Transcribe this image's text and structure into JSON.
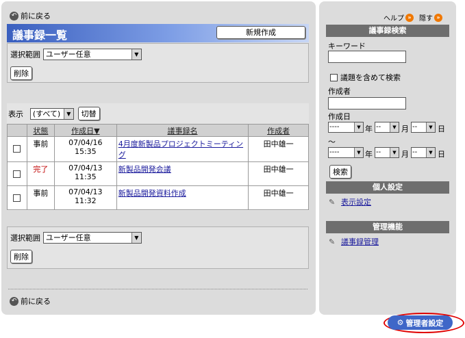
{
  "nav": {
    "back_label": "前に戻る"
  },
  "header": {
    "title": "議事録一覧",
    "new_button": "新規作成"
  },
  "top_filter": {
    "range_label": "選択範囲",
    "range_value": "ユーザー任意",
    "delete_button": "削除"
  },
  "list": {
    "display_label": "表示",
    "display_value": "(すべて)",
    "switch_button": "切替",
    "columns": [
      "状態",
      "作成日▼",
      "議事録名",
      "作成者"
    ],
    "rows": [
      {
        "status": "事前",
        "date": "07/04/16",
        "time": "15:35",
        "name": "4月度新製品プロジェクトミーティング",
        "author": "田中雄一"
      },
      {
        "status": "完了",
        "date": "07/04/13",
        "time": "11:35",
        "name": "新製品開発会議",
        "author": "田中雄一"
      },
      {
        "status": "事前",
        "date": "07/04/13",
        "time": "11:32",
        "name": "新製品開発資料作成",
        "author": "田中雄一"
      }
    ]
  },
  "bottom_filter": {
    "range_label": "選択範囲",
    "range_value": "ユーザー任意",
    "delete_button": "削除"
  },
  "right": {
    "help_label": "ヘルプ",
    "hide_label": "隠す",
    "search_header": "議事録検索",
    "keyword_label": "キーワード",
    "include_title_label": "議題を含めて検索",
    "author_label": "作成者",
    "date_label": "作成日",
    "year_unit": "年",
    "month_unit": "月",
    "day_unit": "日",
    "range_mark": "～",
    "year_placeholder": "----",
    "mmdd_placeholder": "--",
    "search_button": "検索",
    "personal_header": "個人設定",
    "display_settings_link": "表示設定",
    "admin_header": "管理機能",
    "minutes_admin_link": "議事録管理"
  },
  "admin_button": "管理者設定",
  "colors": {
    "accent": "#3a5fbf",
    "status_done": "#c00000",
    "link": "#1a1a9c"
  }
}
